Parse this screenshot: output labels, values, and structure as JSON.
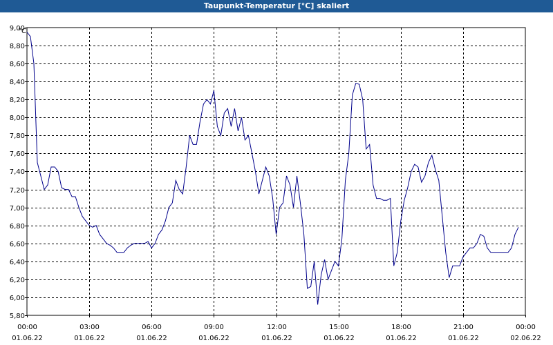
{
  "window": {
    "title": "Taupunkt-Temperatur [°C] skaliert"
  },
  "chart_data": {
    "type": "line",
    "title": "Taupunkt-Temperatur [°C] skaliert",
    "ylabel": "°C",
    "xlabel": "",
    "ylim": [
      5.8,
      9.0
    ],
    "yticks": [
      "5,80",
      "6,00",
      "6,20",
      "6,40",
      "6,60",
      "6,80",
      "7,00",
      "7,20",
      "7,40",
      "7,60",
      "7,80",
      "8,00",
      "8,20",
      "8,40",
      "8,60",
      "8,80",
      "9,00"
    ],
    "xticks": [
      {
        "time": "00:00",
        "date": "01.06.22"
      },
      {
        "time": "03:00",
        "date": "01.06.22"
      },
      {
        "time": "06:00",
        "date": "01.06.22"
      },
      {
        "time": "09:00",
        "date": "01.06.22"
      },
      {
        "time": "12:00",
        "date": "01.06.22"
      },
      {
        "time": "15:00",
        "date": "01.06.22"
      },
      {
        "time": "18:00",
        "date": "01.06.22"
      },
      {
        "time": "21:00",
        "date": "01.06.22"
      },
      {
        "time": "00:00",
        "date": "02.06.22"
      }
    ],
    "xlim": [
      "01.06.22 00:00",
      "02.06.22 00:00"
    ],
    "grid": true,
    "line_color": "#00008b",
    "series": [
      {
        "values": [
          [
            "00:00",
            8.95
          ],
          [
            "00:10",
            8.9
          ],
          [
            "00:20",
            8.6
          ],
          [
            "00:30",
            7.5
          ],
          [
            "00:40",
            7.35
          ],
          [
            "00:50",
            7.2
          ],
          [
            "01:00",
            7.25
          ],
          [
            "01:10",
            7.45
          ],
          [
            "01:20",
            7.45
          ],
          [
            "01:30",
            7.4
          ],
          [
            "01:40",
            7.22
          ],
          [
            "01:50",
            7.2
          ],
          [
            "02:00",
            7.2
          ],
          [
            "02:10",
            7.12
          ],
          [
            "02:20",
            7.12
          ],
          [
            "02:30",
            7.0
          ],
          [
            "02:40",
            6.9
          ],
          [
            "02:50",
            6.85
          ],
          [
            "03:00",
            6.8
          ],
          [
            "03:10",
            6.78
          ],
          [
            "03:20",
            6.8
          ],
          [
            "03:30",
            6.7
          ],
          [
            "03:40",
            6.65
          ],
          [
            "03:50",
            6.6
          ],
          [
            "04:00",
            6.58
          ],
          [
            "04:10",
            6.55
          ],
          [
            "04:20",
            6.5
          ],
          [
            "04:30",
            6.5
          ],
          [
            "04:40",
            6.5
          ],
          [
            "04:50",
            6.55
          ],
          [
            "05:00",
            6.58
          ],
          [
            "05:10",
            6.6
          ],
          [
            "05:20",
            6.6
          ],
          [
            "05:30",
            6.6
          ],
          [
            "05:40",
            6.6
          ],
          [
            "05:50",
            6.62
          ],
          [
            "06:00",
            6.55
          ],
          [
            "06:10",
            6.6
          ],
          [
            "06:20",
            6.7
          ],
          [
            "06:30",
            6.75
          ],
          [
            "06:40",
            6.85
          ],
          [
            "06:50",
            7.0
          ],
          [
            "07:00",
            7.05
          ],
          [
            "07:10",
            7.3
          ],
          [
            "07:20",
            7.2
          ],
          [
            "07:30",
            7.15
          ],
          [
            "07:40",
            7.45
          ],
          [
            "07:50",
            7.8
          ],
          [
            "08:00",
            7.7
          ],
          [
            "08:10",
            7.7
          ],
          [
            "08:20",
            7.95
          ],
          [
            "08:30",
            8.15
          ],
          [
            "08:40",
            8.2
          ],
          [
            "08:50",
            8.15
          ],
          [
            "09:00",
            8.3
          ],
          [
            "09:10",
            7.9
          ],
          [
            "09:20",
            7.8
          ],
          [
            "09:30",
            8.05
          ],
          [
            "09:40",
            8.1
          ],
          [
            "09:50",
            7.9
          ],
          [
            "10:00",
            8.1
          ],
          [
            "10:10",
            7.85
          ],
          [
            "10:20",
            8.0
          ],
          [
            "10:30",
            7.75
          ],
          [
            "10:40",
            7.8
          ],
          [
            "10:50",
            7.6
          ],
          [
            "11:00",
            7.4
          ],
          [
            "11:10",
            7.15
          ],
          [
            "11:20",
            7.3
          ],
          [
            "11:30",
            7.45
          ],
          [
            "11:40",
            7.35
          ],
          [
            "11:50",
            7.1
          ],
          [
            "12:00",
            6.7
          ],
          [
            "12:10",
            7.0
          ],
          [
            "12:20",
            7.05
          ],
          [
            "12:30",
            7.35
          ],
          [
            "12:40",
            7.25
          ],
          [
            "12:50",
            7.0
          ],
          [
            "13:00",
            7.35
          ],
          [
            "13:10",
            7.05
          ],
          [
            "13:20",
            6.7
          ],
          [
            "13:30",
            6.1
          ],
          [
            "13:40",
            6.12
          ],
          [
            "13:50",
            6.4
          ],
          [
            "14:00",
            5.92
          ],
          [
            "14:10",
            6.25
          ],
          [
            "14:20",
            6.42
          ],
          [
            "14:30",
            6.2
          ],
          [
            "14:40",
            6.3
          ],
          [
            "14:50",
            6.4
          ],
          [
            "15:00",
            6.35
          ],
          [
            "15:10",
            6.65
          ],
          [
            "15:20",
            7.3
          ],
          [
            "15:30",
            7.6
          ],
          [
            "15:40",
            8.25
          ],
          [
            "15:50",
            8.38
          ],
          [
            "16:00",
            8.37
          ],
          [
            "16:10",
            8.2
          ],
          [
            "16:20",
            7.65
          ],
          [
            "16:30",
            7.7
          ],
          [
            "16:40",
            7.25
          ],
          [
            "16:50",
            7.1
          ],
          [
            "17:00",
            7.1
          ],
          [
            "17:10",
            7.08
          ],
          [
            "17:20",
            7.08
          ],
          [
            "17:30",
            7.1
          ],
          [
            "17:40",
            6.35
          ],
          [
            "17:50",
            6.5
          ],
          [
            "18:00",
            6.85
          ],
          [
            "18:10",
            7.08
          ],
          [
            "18:20",
            7.22
          ],
          [
            "18:30",
            7.4
          ],
          [
            "18:40",
            7.48
          ],
          [
            "18:50",
            7.45
          ],
          [
            "19:00",
            7.28
          ],
          [
            "19:10",
            7.35
          ],
          [
            "19:20",
            7.5
          ],
          [
            "19:30",
            7.58
          ],
          [
            "19:40",
            7.42
          ],
          [
            "19:50",
            7.3
          ],
          [
            "20:00",
            6.9
          ],
          [
            "20:10",
            6.5
          ],
          [
            "20:20",
            6.22
          ],
          [
            "20:30",
            6.35
          ],
          [
            "20:40",
            6.35
          ],
          [
            "20:50",
            6.35
          ],
          [
            "21:00",
            6.45
          ],
          [
            "21:10",
            6.5
          ],
          [
            "21:20",
            6.55
          ],
          [
            "21:30",
            6.55
          ],
          [
            "21:40",
            6.6
          ],
          [
            "21:50",
            6.7
          ],
          [
            "22:00",
            6.68
          ],
          [
            "22:10",
            6.55
          ],
          [
            "22:20",
            6.5
          ],
          [
            "22:30",
            6.5
          ],
          [
            "22:40",
            6.5
          ],
          [
            "22:50",
            6.5
          ],
          [
            "23:00",
            6.5
          ],
          [
            "23:10",
            6.5
          ],
          [
            "23:20",
            6.55
          ],
          [
            "23:30",
            6.7
          ],
          [
            "23:40",
            6.78
          ]
        ]
      }
    ]
  }
}
